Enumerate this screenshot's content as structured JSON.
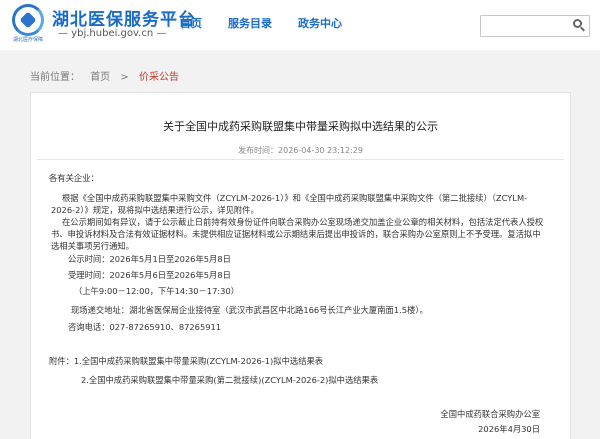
{
  "header": {
    "logo_caption": "湖北医疗保障",
    "site_title": "湖北医保服务平台",
    "site_url": "— ybj.hubei.gov.cn —",
    "nav": [
      {
        "label": "首页"
      },
      {
        "label": "服务目录"
      },
      {
        "label": "政务中心"
      }
    ],
    "search": {
      "value": "",
      "placeholder": ""
    }
  },
  "breadcrumb": {
    "prefix": "当前位置：",
    "home": "首页",
    "separator": ">",
    "current": "价采公告"
  },
  "article": {
    "title": "关于全国中成药采购联盟集中带量采购拟中选结果的公示",
    "publish_time": "发布时间：2026-04-30 23:12:29",
    "salutation": "各有关企业：",
    "para1": "根据《全国中成药采购联盟集中采购文件（ZCYLM-2026-1）》和《全国中成药采购联盟集中采购文件（第二批接续）（ZCYLM-2026-2）》规定，现将拟中选结果进行公示，详见附件。",
    "para2": "在公示期间如有异议，请于公示截止日前持有效身份证件向联合采购办公室现场递交加盖企业公章的相关材料，包括法定代表人授权书、申投诉材料及合法有效证据材料。未提供相应证据材料或公示期结束后提出申投诉的，联合采购办公室原则上不予受理。复活拟中选相关事项另行通知。",
    "notice_period": "公示时间：2026年5月1日至2026年5月8日",
    "accept_period": "受理时间：2026年5月6日至2026年5月8日",
    "accept_hours": "（上午9:00－12:00，下午14:30－17:30）",
    "location": "现场递交地址：湖北省医保局企业接待室（武汉市武昌区中北路166号长江产业大厦南面1.5楼）。",
    "phone": "咨询电话：027-87265910、87265911",
    "attachment1": "附件：1.全国中成药采购联盟集中带量采购(ZCYLM-2026-1)拟中选结果表",
    "attachment2": "2.全国中成药采购联盟集中带量采购(第二批接续)(ZCYLM-2026-2)拟中选结果表",
    "signature_org": "全国中成药联合采购办公室",
    "signature_date": "2026年4月30日"
  }
}
